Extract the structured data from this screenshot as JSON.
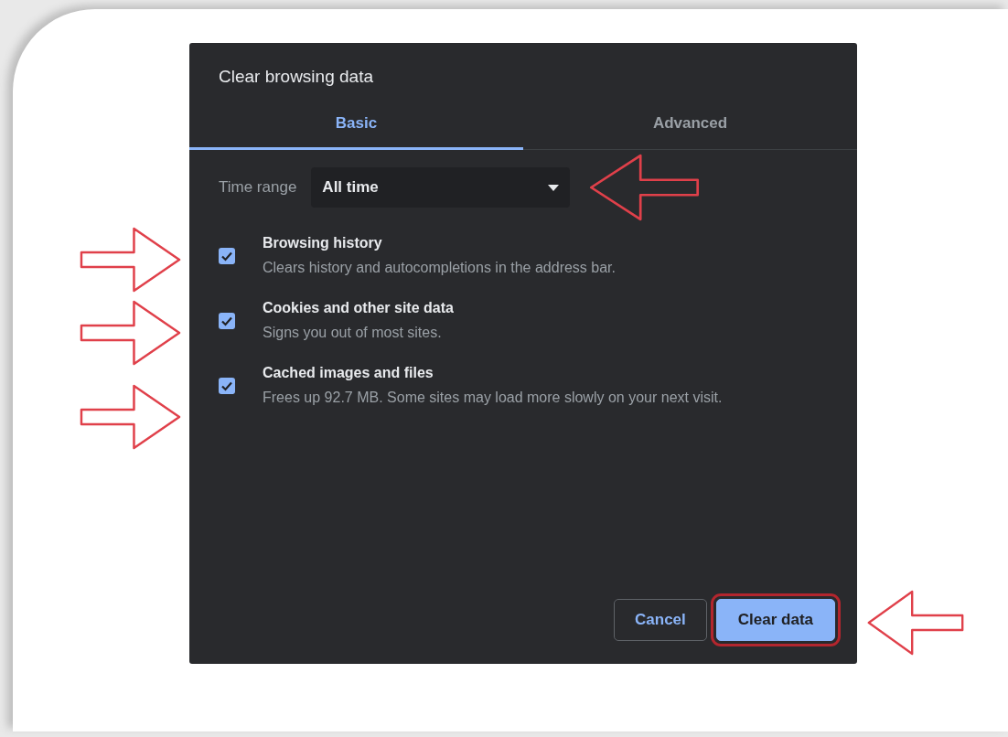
{
  "dialog": {
    "title": "Clear browsing data",
    "tabs": [
      {
        "label": "Basic",
        "selected": true
      },
      {
        "label": "Advanced",
        "selected": false
      }
    ],
    "time_range": {
      "label": "Time range",
      "value": "All time"
    },
    "items": [
      {
        "title": "Browsing history",
        "description": "Clears history and autocompletions in the address bar.",
        "checked": true
      },
      {
        "title": "Cookies and other site data",
        "description": "Signs you out of most sites.",
        "checked": true
      },
      {
        "title": "Cached images and files",
        "description": "Frees up 92.7 MB. Some sites may load more slowly on your next visit.",
        "checked": true
      }
    ],
    "buttons": [
      {
        "label": "Cancel",
        "kind": "secondary",
        "circled": false
      },
      {
        "label": "Clear data",
        "kind": "primary",
        "circled": true
      }
    ]
  }
}
